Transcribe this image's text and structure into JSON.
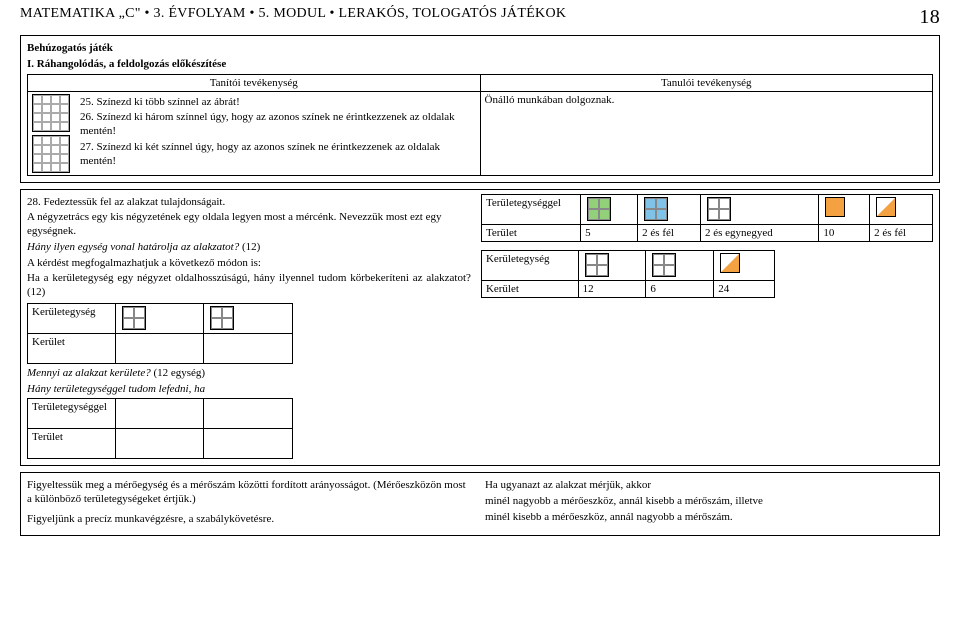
{
  "header": {
    "breadcrumb": "MATEMATIKA „C\" • 3. ÉVFOLYAM • 5. MODUL • LERAKÓS, TOLOGATÓS JÁTÉKOK",
    "page": "18"
  },
  "section1": {
    "title": "Behúzogatós játék",
    "subtitle": "I. Ráhangolódás, a feldolgozás előkészítése",
    "teacher_heading": "Tanítói tevékenység",
    "student_heading": "Tanulói tevékenység",
    "tasks": {
      "t25": "25. Színezd ki több színnel az ábrát!",
      "t26": "26. Színezd ki három színnel úgy, hogy az azonos színek ne érintkezzenek az oldalak mentén!",
      "t27": "27. Színezd ki két színnel úgy, hogy az azonos színek ne érintkezzenek az oldalak mentén!"
    },
    "student_text": "Önálló munkában dolgoznak."
  },
  "section2": {
    "para1": "28. Fedeztessük fel az alakzat tulajdonságait.",
    "para2": "A négyzetrács egy kis négyzetének egy oldala legyen most a mércénk. Nevezzük most ezt egy egységnek.",
    "para3_i": "Hány ilyen egység vonal határolja az alakzatot?",
    "para3_r": " (12)",
    "para4": "A kérdést megfogalmazhatjuk a következő módon is:",
    "para5": "Ha a kerületegység egy négyzet oldalhosszúságú, hány ilyennel tudom körbekeríteni az alakzatot? (12)",
    "label_keruletegyseg": "Kerületegység",
    "label_kerulet": "Kerület",
    "para6_i": "Mennyi az alakzat kerülete?",
    "para6_r": " (12 egység)",
    "para7_i": "Hány területegységgel tudom lefedni, ha",
    "label_teruletegyseggel": "Területegységgel",
    "label_terulet": "Terület",
    "right": {
      "row1_label": "Területegységgel",
      "row2_label": "Terület",
      "row2_vals": [
        "5",
        "2 és fél",
        "2 és egynegyed",
        "10",
        "2 és fél"
      ],
      "row3_label": "Kerületegység",
      "row4_label": "Kerület",
      "row4_vals": [
        "12",
        "6",
        "24"
      ]
    }
  },
  "section3": {
    "left1": "Figyeltessük meg a mérőegység és a mérőszám közötti fordított arányosságot. (Mérőeszközön most a különböző területegységeket értjük.)",
    "left2": "Figyeljünk a precíz munkavégzésre, a szabálykövetésre.",
    "right1": "Ha ugyanazt az alakzat mérjük, akkor",
    "right2": "minél nagyobb a mérőeszköz, annál kisebb a mérőszám, illetve",
    "right3": "minél kisebb a mérőeszköz, annál nagyobb a mérőszám."
  }
}
